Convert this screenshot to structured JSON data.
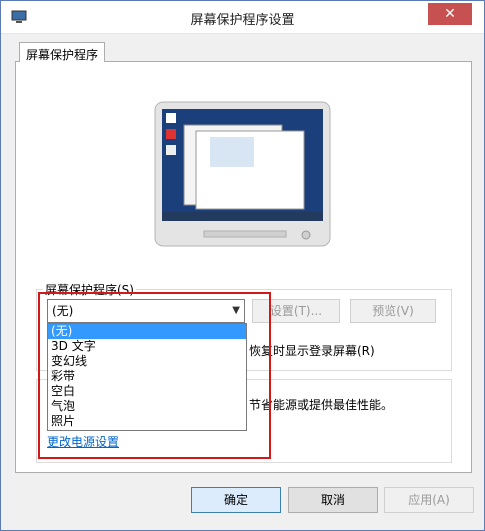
{
  "window": {
    "title": "屏幕保护程序设置",
    "close_label": "✕"
  },
  "tab": {
    "label": "屏幕保护程序"
  },
  "screensaver": {
    "group_label": "屏幕保护程序(S)",
    "selected": "(无)",
    "settings_label": "设置(T)...",
    "preview_label": "预览(V)",
    "options": [
      "(无)",
      "3D 文字",
      "变幻线",
      "彩带",
      "空白",
      "气泡",
      "照片"
    ],
    "restore_text": "恢复时显示登录屏幕(R)"
  },
  "power": {
    "text": "节省能源或提供最佳性能。",
    "link": "更改电源设置"
  },
  "buttons": {
    "ok": "确定",
    "cancel": "取消",
    "apply": "应用(A)"
  },
  "colors": {
    "highlight": "#d01a1a",
    "selection": "#3399ff",
    "close": "#c75050"
  }
}
